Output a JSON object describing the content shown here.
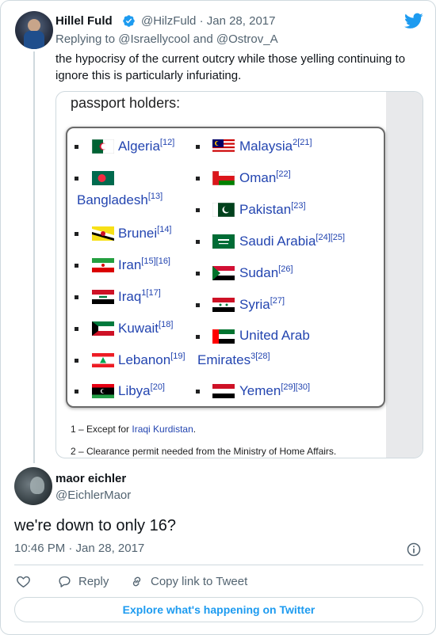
{
  "quoted_tweet": {
    "author_name": "Hillel Fuld",
    "handle_date": "@HilzFuld · Jan 28, 2017",
    "replying_prefix": "Replying to ",
    "replying_to_1": "@Israellycool",
    "replying_and": " and ",
    "replying_to_2": "@Ostrov_A",
    "text": "the hypocrisy of the current outcry while those yelling continuing to ignore this is particularly infuriating.",
    "image": {
      "heading": "passport holders:",
      "left_column": [
        {
          "name": "Algeria",
          "refs": "[12]"
        },
        {
          "name": "",
          "refs": ""
        },
        {
          "name": "Bangladesh",
          "refs": "[13]"
        },
        {
          "name": "Brunei",
          "refs": "[14]"
        },
        {
          "name": "Iran",
          "refs": "[15][16]"
        },
        {
          "name": "Iraq",
          "refs": "1[17]"
        },
        {
          "name": "Kuwait",
          "refs": "[18]"
        },
        {
          "name": "Lebanon",
          "refs": "[19]"
        },
        {
          "name": "Libya",
          "refs": "[20]"
        }
      ],
      "right_column": [
        {
          "name": "Malaysia",
          "refs": "2[21]"
        },
        {
          "name": "Oman",
          "refs": "[22]"
        },
        {
          "name": "Pakistan",
          "refs": "[23]"
        },
        {
          "name": "Saudi Arabia",
          "refs": "[24][25]"
        },
        {
          "name": "Sudan",
          "refs": "[26]"
        },
        {
          "name": "Syria",
          "refs": "[27]"
        },
        {
          "name": "United Arab",
          "refs": ""
        },
        {
          "name": "Emirates",
          "refs": "3[28]"
        },
        {
          "name": "Yemen",
          "refs": "[29][30]"
        }
      ],
      "footnote_1_prefix": "1 – Except for ",
      "footnote_1_link": "Iraqi Kurdistan",
      "footnote_1_suffix": ".",
      "footnote_2": "2 – Clearance permit needed from the Ministry of Home Affairs."
    }
  },
  "tweet": {
    "author_name": "maor eichler",
    "handle": "@EichlerMaor",
    "text": "we're down to only 16?",
    "timestamp": "10:46 PM · Jan 28, 2017"
  },
  "actions": {
    "reply": "Reply",
    "copy_link": "Copy link to Tweet"
  },
  "explore_button": "Explore what's happening on Twitter",
  "colors": {
    "twitter_blue": "#1d9bf0",
    "like_red": "#f91880",
    "link_blue": "#2345b0"
  }
}
